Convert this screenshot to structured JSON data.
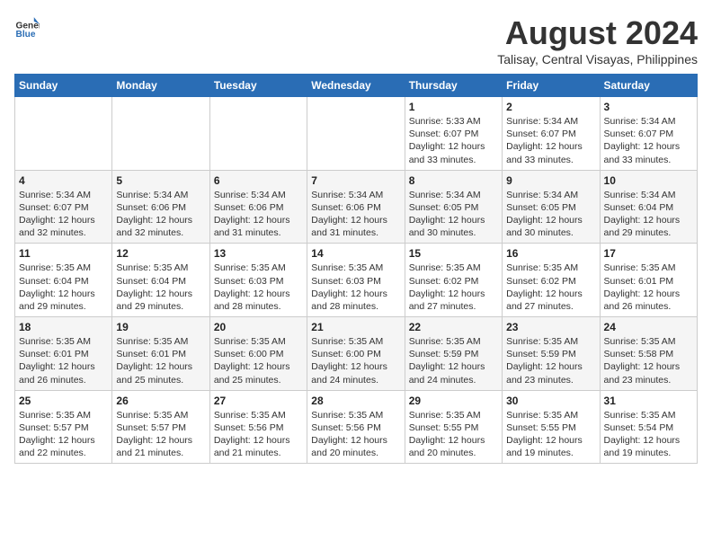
{
  "logo": {
    "line1": "General",
    "line2": "Blue"
  },
  "title": "August 2024",
  "subtitle": "Talisay, Central Visayas, Philippines",
  "weekdays": [
    "Sunday",
    "Monday",
    "Tuesday",
    "Wednesday",
    "Thursday",
    "Friday",
    "Saturday"
  ],
  "weeks": [
    [
      {
        "day": "",
        "info": ""
      },
      {
        "day": "",
        "info": ""
      },
      {
        "day": "",
        "info": ""
      },
      {
        "day": "",
        "info": ""
      },
      {
        "day": "1",
        "info": "Sunrise: 5:33 AM\nSunset: 6:07 PM\nDaylight: 12 hours\nand 33 minutes."
      },
      {
        "day": "2",
        "info": "Sunrise: 5:34 AM\nSunset: 6:07 PM\nDaylight: 12 hours\nand 33 minutes."
      },
      {
        "day": "3",
        "info": "Sunrise: 5:34 AM\nSunset: 6:07 PM\nDaylight: 12 hours\nand 33 minutes."
      }
    ],
    [
      {
        "day": "4",
        "info": "Sunrise: 5:34 AM\nSunset: 6:07 PM\nDaylight: 12 hours\nand 32 minutes."
      },
      {
        "day": "5",
        "info": "Sunrise: 5:34 AM\nSunset: 6:06 PM\nDaylight: 12 hours\nand 32 minutes."
      },
      {
        "day": "6",
        "info": "Sunrise: 5:34 AM\nSunset: 6:06 PM\nDaylight: 12 hours\nand 31 minutes."
      },
      {
        "day": "7",
        "info": "Sunrise: 5:34 AM\nSunset: 6:06 PM\nDaylight: 12 hours\nand 31 minutes."
      },
      {
        "day": "8",
        "info": "Sunrise: 5:34 AM\nSunset: 6:05 PM\nDaylight: 12 hours\nand 30 minutes."
      },
      {
        "day": "9",
        "info": "Sunrise: 5:34 AM\nSunset: 6:05 PM\nDaylight: 12 hours\nand 30 minutes."
      },
      {
        "day": "10",
        "info": "Sunrise: 5:34 AM\nSunset: 6:04 PM\nDaylight: 12 hours\nand 29 minutes."
      }
    ],
    [
      {
        "day": "11",
        "info": "Sunrise: 5:35 AM\nSunset: 6:04 PM\nDaylight: 12 hours\nand 29 minutes."
      },
      {
        "day": "12",
        "info": "Sunrise: 5:35 AM\nSunset: 6:04 PM\nDaylight: 12 hours\nand 29 minutes."
      },
      {
        "day": "13",
        "info": "Sunrise: 5:35 AM\nSunset: 6:03 PM\nDaylight: 12 hours\nand 28 minutes."
      },
      {
        "day": "14",
        "info": "Sunrise: 5:35 AM\nSunset: 6:03 PM\nDaylight: 12 hours\nand 28 minutes."
      },
      {
        "day": "15",
        "info": "Sunrise: 5:35 AM\nSunset: 6:02 PM\nDaylight: 12 hours\nand 27 minutes."
      },
      {
        "day": "16",
        "info": "Sunrise: 5:35 AM\nSunset: 6:02 PM\nDaylight: 12 hours\nand 27 minutes."
      },
      {
        "day": "17",
        "info": "Sunrise: 5:35 AM\nSunset: 6:01 PM\nDaylight: 12 hours\nand 26 minutes."
      }
    ],
    [
      {
        "day": "18",
        "info": "Sunrise: 5:35 AM\nSunset: 6:01 PM\nDaylight: 12 hours\nand 26 minutes."
      },
      {
        "day": "19",
        "info": "Sunrise: 5:35 AM\nSunset: 6:01 PM\nDaylight: 12 hours\nand 25 minutes."
      },
      {
        "day": "20",
        "info": "Sunrise: 5:35 AM\nSunset: 6:00 PM\nDaylight: 12 hours\nand 25 minutes."
      },
      {
        "day": "21",
        "info": "Sunrise: 5:35 AM\nSunset: 6:00 PM\nDaylight: 12 hours\nand 24 minutes."
      },
      {
        "day": "22",
        "info": "Sunrise: 5:35 AM\nSunset: 5:59 PM\nDaylight: 12 hours\nand 24 minutes."
      },
      {
        "day": "23",
        "info": "Sunrise: 5:35 AM\nSunset: 5:59 PM\nDaylight: 12 hours\nand 23 minutes."
      },
      {
        "day": "24",
        "info": "Sunrise: 5:35 AM\nSunset: 5:58 PM\nDaylight: 12 hours\nand 23 minutes."
      }
    ],
    [
      {
        "day": "25",
        "info": "Sunrise: 5:35 AM\nSunset: 5:57 PM\nDaylight: 12 hours\nand 22 minutes."
      },
      {
        "day": "26",
        "info": "Sunrise: 5:35 AM\nSunset: 5:57 PM\nDaylight: 12 hours\nand 21 minutes."
      },
      {
        "day": "27",
        "info": "Sunrise: 5:35 AM\nSunset: 5:56 PM\nDaylight: 12 hours\nand 21 minutes."
      },
      {
        "day": "28",
        "info": "Sunrise: 5:35 AM\nSunset: 5:56 PM\nDaylight: 12 hours\nand 20 minutes."
      },
      {
        "day": "29",
        "info": "Sunrise: 5:35 AM\nSunset: 5:55 PM\nDaylight: 12 hours\nand 20 minutes."
      },
      {
        "day": "30",
        "info": "Sunrise: 5:35 AM\nSunset: 5:55 PM\nDaylight: 12 hours\nand 19 minutes."
      },
      {
        "day": "31",
        "info": "Sunrise: 5:35 AM\nSunset: 5:54 PM\nDaylight: 12 hours\nand 19 minutes."
      }
    ]
  ]
}
